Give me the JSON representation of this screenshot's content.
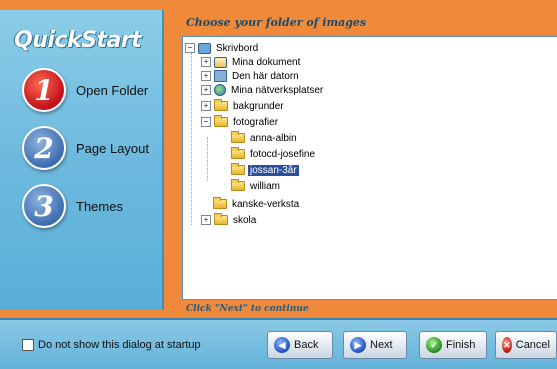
{
  "app": {
    "title": "QuickStart"
  },
  "steps": [
    {
      "number": "1",
      "label": "Open Folder",
      "state": "active"
    },
    {
      "number": "2",
      "label": "Page Layout",
      "state": "idle"
    },
    {
      "number": "3",
      "label": "Themes",
      "state": "idle"
    }
  ],
  "panel": {
    "title": "Choose your folder of images",
    "hint": "Click \"Next\" to continue"
  },
  "tree": {
    "root": "Skrivbord",
    "items": [
      {
        "label": "Mina dokument",
        "icon": "documents-folder-icon",
        "expander": "+"
      },
      {
        "label": "Den här datorn",
        "icon": "computer-icon",
        "expander": "+"
      },
      {
        "label": "Mina nätverksplatser",
        "icon": "network-icon",
        "expander": "+"
      },
      {
        "label": "bakgrunder",
        "icon": "folder-icon",
        "expander": "+"
      },
      {
        "label": "fotografier",
        "icon": "folder-icon",
        "expander": "-"
      },
      {
        "label": "anna-albin",
        "icon": "folder-icon",
        "expander": ""
      },
      {
        "label": "fotocd-josefine",
        "icon": "folder-icon",
        "expander": ""
      },
      {
        "label": "jossan-3år",
        "icon": "folder-icon",
        "expander": "",
        "selected": true
      },
      {
        "label": "william",
        "icon": "folder-icon",
        "expander": ""
      },
      {
        "label": "kanske-verksta",
        "icon": "folder-icon",
        "expander": ""
      },
      {
        "label": "skola",
        "icon": "folder-icon",
        "expander": "+"
      }
    ]
  },
  "footer": {
    "checkbox_label": "Do not show this dialog at startup",
    "checked": false,
    "buttons": {
      "back": "Back",
      "next": "Next",
      "finish": "Finish",
      "cancel": "Cancel"
    }
  },
  "colors": {
    "frame": "#f08a3a",
    "sidebar": "#6db9de",
    "selection": "#2a4f9b"
  }
}
